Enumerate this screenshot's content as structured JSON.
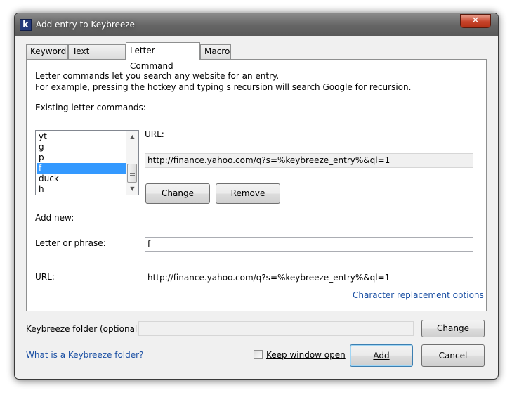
{
  "window": {
    "title": "Add entry to Keybreeze",
    "app_icon": "k",
    "close_glyph": "✕"
  },
  "tabs": [
    {
      "label": "Keyword"
    },
    {
      "label": "Text Function"
    },
    {
      "label": "Letter Command"
    },
    {
      "label": "Macro"
    }
  ],
  "active_tab": "Letter Command",
  "letter_command": {
    "description_line1": "Letter commands let you search any website for an entry.",
    "description_line2": "For example, pressing the hotkey and typing s recursion will search Google for recursion.",
    "existing_label": "Existing letter commands:",
    "existing_items": [
      "yt",
      "g",
      "p",
      "f",
      "duck",
      "h"
    ],
    "selected_item": "f",
    "url_label": "URL:",
    "url_value": "http://finance.yahoo.com/q?s=%keybreeze_entry%&ql=1",
    "change_button": "Change",
    "remove_button": "Remove",
    "add_new_label": "Add new:",
    "letter_label": "Letter or phrase:",
    "letter_value": "f",
    "new_url_label": "URL:",
    "new_url_value": "http://finance.yahoo.com/q?s=%keybreeze_entry%&ql=1",
    "char_replacement_link": "Character replacement options"
  },
  "footer": {
    "folder_label": "Keybreeze folder (optional):",
    "folder_value": "",
    "folder_change_button": "Change",
    "help_link": "What is a Keybreeze folder?",
    "keep_open_label": "Keep window open",
    "keep_open_checked": false,
    "add_button": "Add",
    "cancel_button": "Cancel"
  }
}
